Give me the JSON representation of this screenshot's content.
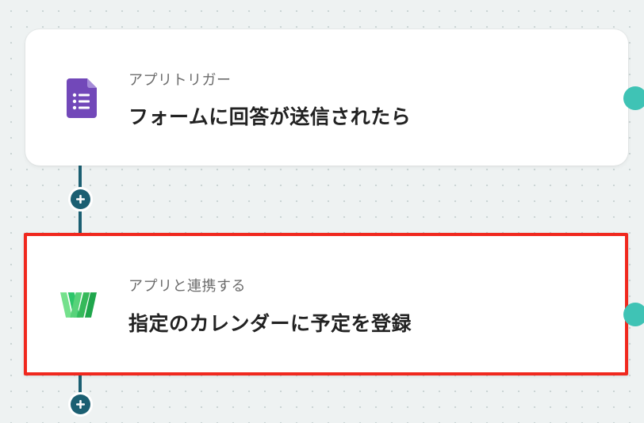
{
  "flow": {
    "steps": [
      {
        "type_label": "アプリトリガー",
        "title": "フォームに回答が送信されたら",
        "app_icon": "google-forms-icon"
      },
      {
        "type_label": "アプリと連携する",
        "title": "指定のカレンダーに予定を登録",
        "app_icon": "w-calendar-app-icon",
        "highlighted": true
      }
    ],
    "add_step_icon": "plus-icon"
  },
  "colors": {
    "connector": "#1b5f72",
    "highlight_border": "#f0281e",
    "forms_purple": "#7248b9",
    "w_green": "#2dc66a"
  }
}
